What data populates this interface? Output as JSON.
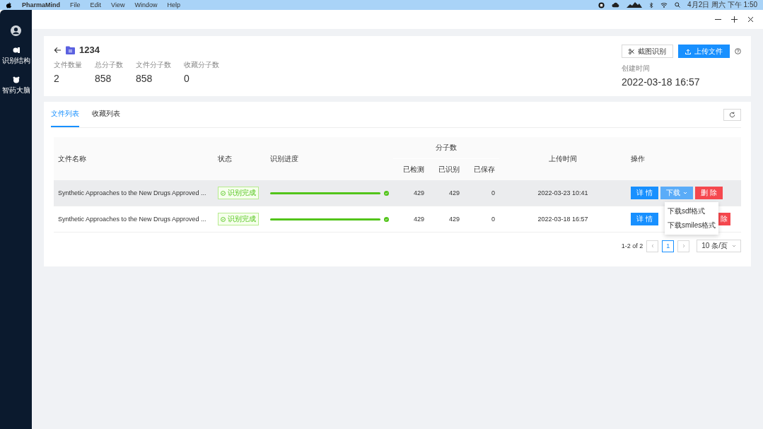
{
  "menubar": {
    "app": "PharmaMind",
    "menus": [
      "File",
      "Edit",
      "View",
      "Window",
      "Help"
    ],
    "clock": "4月2日 周六 下午 1:50"
  },
  "sidebar": {
    "items": [
      {
        "label": "识别结构"
      },
      {
        "label": "智药大脑"
      }
    ]
  },
  "header": {
    "title": "1234",
    "stats": [
      {
        "label": "文件数量",
        "value": "2"
      },
      {
        "label": "总分子数",
        "value": "858"
      },
      {
        "label": "文件分子数",
        "value": "858"
      },
      {
        "label": "收藏分子数",
        "value": "0"
      }
    ],
    "buttons": [
      {
        "label": "截图识别",
        "kind": "default"
      },
      {
        "label": "上传文件",
        "kind": "primary"
      }
    ],
    "created": {
      "label": "创建时间",
      "value": "2022-03-18 16:57"
    }
  },
  "tabs": [
    {
      "label": "文件列表",
      "selected": true
    },
    {
      "label": "收藏列表",
      "selected": false
    }
  ],
  "table": {
    "columns": {
      "name": "文件名称",
      "status": "状态",
      "progress": "识别进度",
      "molecules": "分子数",
      "detected": "已检测",
      "recognized": "已识别",
      "saved": "已保存",
      "time": "上传时间",
      "actions": "操作"
    },
    "rows": [
      {
        "name": "Synthetic Approaches to the New Drugs Approved ...",
        "status": "识别完成",
        "level": 1,
        "detected": "429",
        "recognized": "429",
        "saved": "0",
        "time": "2022-03-23 10:41",
        "selected": true,
        "actions": [
          {
            "label": "详 情",
            "kind": "primary"
          },
          {
            "label": "下载",
            "kind": "dropdown"
          },
          {
            "label": "删 除",
            "kind": "danger"
          }
        ]
      },
      {
        "name": "Synthetic Approaches to the New Drugs Approved ...",
        "status": "识别完成",
        "level": 1,
        "detected": "429",
        "recognized": "429",
        "saved": "0",
        "time": "2022-03-18 16:57",
        "selected": false,
        "actions": [
          {
            "label": "详 情",
            "kind": "primary"
          },
          {
            "label": "除",
            "kind": "danger-covered"
          }
        ]
      }
    ]
  },
  "dropdown": {
    "items": [
      "下载sdf格式",
      "下载smiles格式"
    ]
  },
  "pagination": {
    "range": "1-2 of 2",
    "pages": [
      {
        "label": "1",
        "selected": true
      }
    ],
    "page_size": "10 条/页"
  }
}
